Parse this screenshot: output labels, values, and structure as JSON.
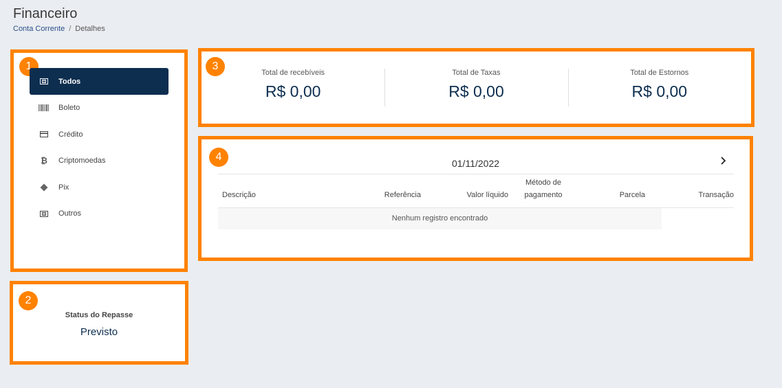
{
  "header": {
    "title": "Financeiro",
    "breadcrumb": {
      "link": "Conta Corrente",
      "separator": "/",
      "current": "Detalhes"
    }
  },
  "markers": [
    "1",
    "2",
    "3",
    "4"
  ],
  "menu": {
    "items": [
      {
        "label": "Todos",
        "icon": "cash-icon",
        "active": true
      },
      {
        "label": "Boleto",
        "icon": "barcode-icon",
        "active": false
      },
      {
        "label": "Crédito",
        "icon": "credit-card-icon",
        "active": false
      },
      {
        "label": "Criptomoedas",
        "icon": "bitcoin-icon",
        "active": false
      },
      {
        "label": "Pix",
        "icon": "pix-icon",
        "active": false
      },
      {
        "label": "Outros",
        "icon": "cash-icon",
        "active": false
      }
    ]
  },
  "status": {
    "label": "Status do Repasse",
    "value": "Previsto"
  },
  "totals": [
    {
      "label": "Total de recebíveis",
      "value": "R$ 0,00"
    },
    {
      "label": "Total de Taxas",
      "value": "R$ 0,00"
    },
    {
      "label": "Total de Estornos",
      "value": "R$ 0,00"
    }
  ],
  "table": {
    "date": "01/11/2022",
    "columns": [
      "Descrição",
      "Referência",
      "Valor líquido",
      "Método de pagamento",
      "Parcela",
      "Transação"
    ],
    "column_lines": [
      [
        "Descrição"
      ],
      [
        "Referência"
      ],
      [
        "Valor líquido"
      ],
      [
        "Método de",
        "pagamento"
      ],
      [
        "Parcela"
      ],
      [
        "Transação"
      ]
    ],
    "empty_message": "Nenhum registro encontrado"
  },
  "colors": {
    "accent": "#ff8200",
    "primary": "#0d2e4f",
    "background": "#eaedf1"
  }
}
